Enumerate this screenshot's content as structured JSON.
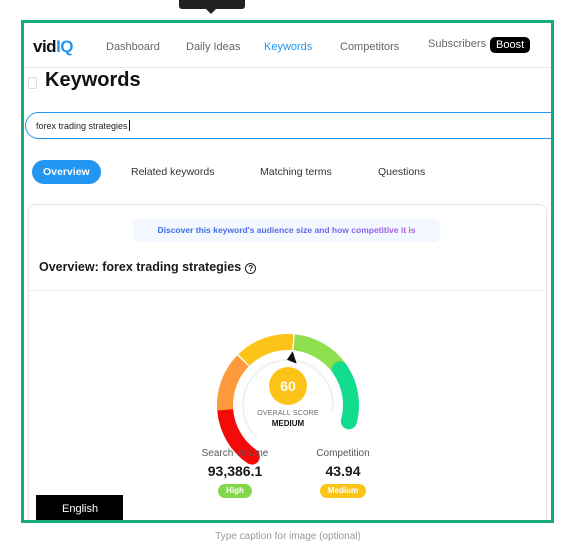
{
  "nav": {
    "logo_prefix": "vid",
    "logo_suffix": "IQ",
    "items": [
      {
        "label": "Dashboard",
        "active": false
      },
      {
        "label": "Daily Ideas",
        "active": false
      },
      {
        "label": "Keywords",
        "active": true
      },
      {
        "label": "Competitors",
        "active": false
      },
      {
        "label": "Subscribers",
        "active": false
      }
    ],
    "boost_badge": "Boost"
  },
  "page": {
    "title": "Keywords"
  },
  "search": {
    "value": "forex trading strategies"
  },
  "tabs": [
    {
      "label": "Overview",
      "active": true
    },
    {
      "label": "Related keywords",
      "active": false
    },
    {
      "label": "Matching terms",
      "active": false
    },
    {
      "label": "Questions",
      "active": false
    }
  ],
  "overview": {
    "banner": "Discover this keyword's audience size and how competitive it is",
    "title": "Overview: forex trading strategies",
    "help_icon": "?",
    "gauge": {
      "score": 60,
      "score_max": 100,
      "label": "OVERALL SCORE",
      "level": "MEDIUM",
      "segments": [
        {
          "name": "very-low",
          "color": "#f50a0a"
        },
        {
          "name": "low",
          "color": "#fd9a3c"
        },
        {
          "name": "medium",
          "color": "#fcc419"
        },
        {
          "name": "high",
          "color": "#8ede4d"
        },
        {
          "name": "very-high",
          "color": "#12dc8e"
        }
      ],
      "score_color": "#fcc419"
    },
    "stats": [
      {
        "label": "Search volume",
        "value": "93,386.1",
        "badge": "High",
        "badge_color": "#82d84a"
      },
      {
        "label": "Competition",
        "value": "43.94",
        "badge": "Medium",
        "badge_color": "#fcc419"
      }
    ]
  },
  "language": "English",
  "caption_placeholder": "Type caption for image (optional)",
  "colors": {
    "accent": "#2196f3",
    "frame": "#16a97a"
  }
}
